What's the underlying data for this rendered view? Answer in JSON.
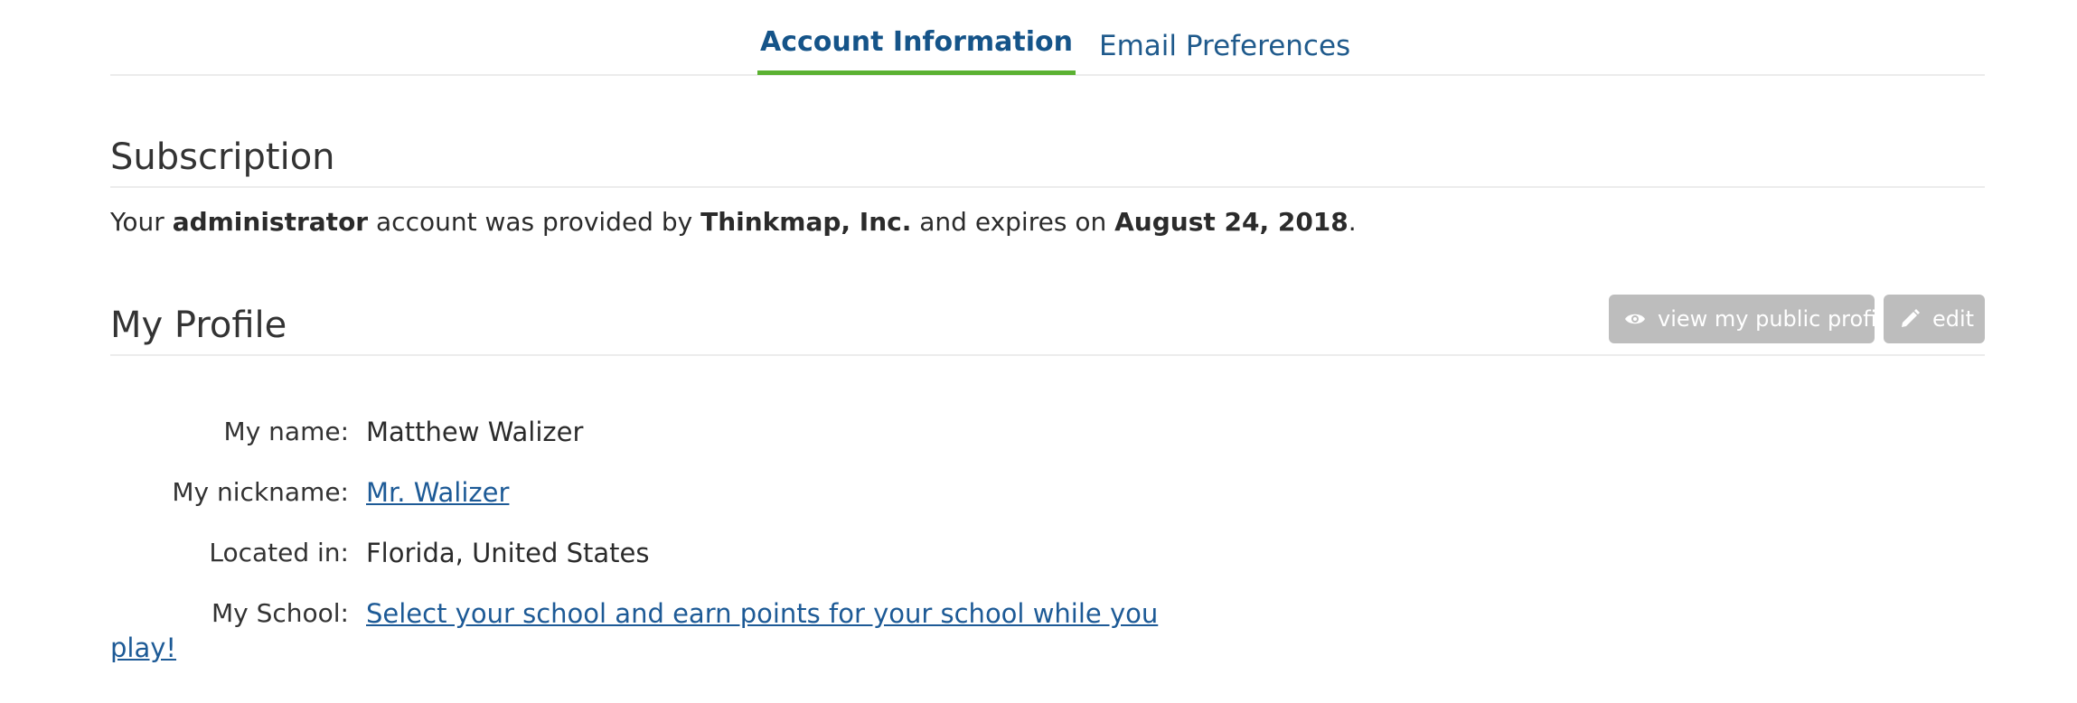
{
  "tabs": {
    "active_label": "Account Information",
    "inactive_label": "Email Preferences"
  },
  "subscription": {
    "title": "Subscription",
    "text_prefix": "Your ",
    "role": "administrator",
    "text_mid1": " account was provided by ",
    "provider": "Thinkmap, Inc.",
    "text_mid2": " and expires on ",
    "expires": "August 24, 2018",
    "text_suffix": "."
  },
  "profile": {
    "title": "My Profile",
    "view_public_label": "view my public profile",
    "edit_label": "edit",
    "view_icon": "eye-icon",
    "edit_icon": "pencil-icon",
    "name_label": "My name:",
    "name_value": "Matthew Walizer",
    "nickname_label": "My nickname:",
    "nickname_value": "Mr. Walizer",
    "location_label": "Located in:",
    "location_value": "Florida, United States",
    "school_label": "My School:",
    "school_link_line1": "Select your school and earn points for your school while you",
    "school_link_line2": "play!"
  },
  "colors": {
    "tab_active_underline": "#5bb132",
    "link": "#1d5a96",
    "button_bg": "#bdbdbd"
  }
}
